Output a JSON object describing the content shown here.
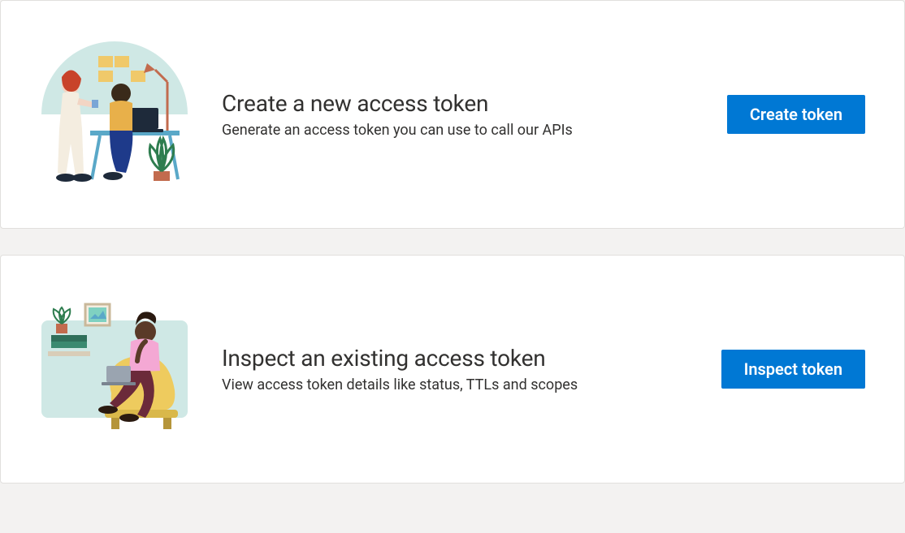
{
  "cards": [
    {
      "title": "Create a new access token",
      "description": "Generate an access token you can use to call our APIs",
      "button": "Create token"
    },
    {
      "title": "Inspect an existing access token",
      "description": "View access token details like status, TTLs and scopes",
      "button": "Inspect token"
    }
  ]
}
